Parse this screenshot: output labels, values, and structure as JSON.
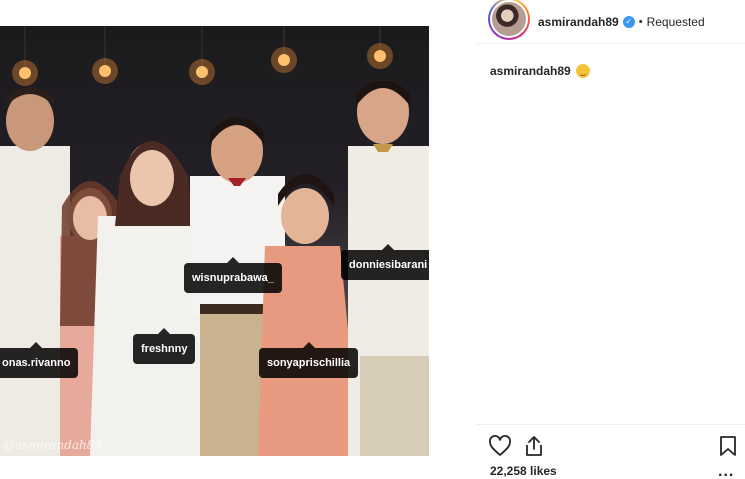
{
  "post": {
    "author": "asmirandah89",
    "follow_status": "Requested",
    "separator": "•",
    "verified_mark": "✓",
    "caption_author": "asmirandah89",
    "caption_emoji": "smiling-face-emoji",
    "likes": "22,258 likes",
    "more_label": "..."
  },
  "photo": {
    "watermark": "@asmirandah89",
    "tags": [
      {
        "label": "wisnuprabawa_"
      },
      {
        "label": "donniesibarani"
      },
      {
        "label": "freshnny"
      },
      {
        "label": "onas.rivanno"
      },
      {
        "label": "sonyaprischillia"
      }
    ]
  },
  "icons": {
    "like": "heart-icon",
    "share": "share-icon",
    "save": "bookmark-icon",
    "verified": "verified-badge-icon"
  },
  "colors": {
    "verified": "#3897f0",
    "text": "#262626",
    "tag_bg": "#000000"
  }
}
